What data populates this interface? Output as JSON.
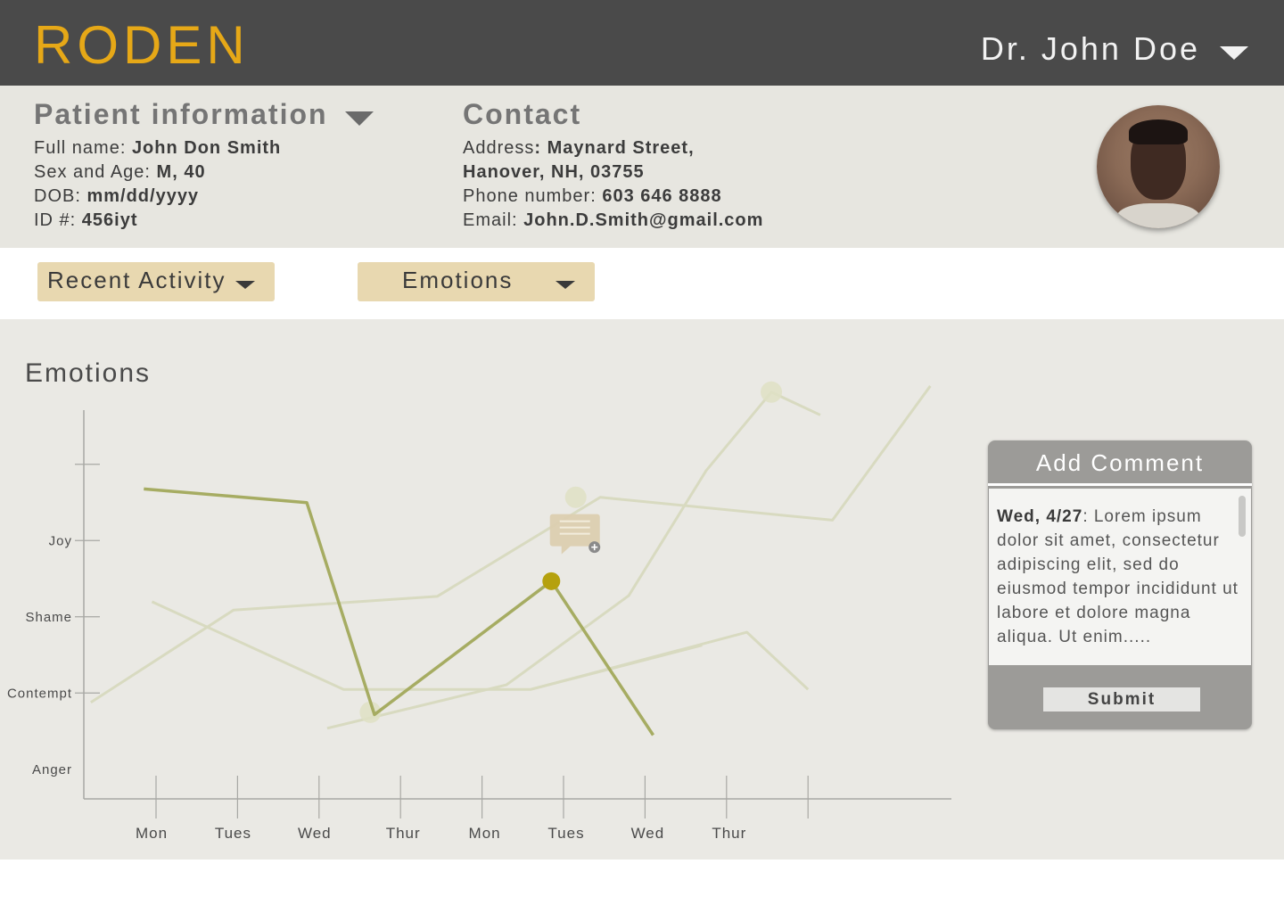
{
  "app": {
    "brand": "RODEN",
    "user": "Dr. John Doe"
  },
  "patient": {
    "title": "Patient information",
    "full_name_label": "Full name: ",
    "full_name": "John Don Smith",
    "sex_age_label": "Sex and Age: ",
    "sex_age": "M, 40",
    "dob_label": "DOB: ",
    "dob": "mm/dd/yyyy",
    "id_label": "ID #: ",
    "id": "456iyt"
  },
  "contact": {
    "title": "Contact",
    "address_label": "Address",
    "address_line1": ": Maynard Street,",
    "address_line2": "Hanover, NH, 03755",
    "phone_label": "Phone number: ",
    "phone": "603 646 8888",
    "email_label": "Email: ",
    "email": "John.D.Smith@gmail.com"
  },
  "filters": {
    "activity": "Recent Activity",
    "metric": "Emotions"
  },
  "comment": {
    "title": "Add Comment",
    "date": "Wed, 4/27",
    "text": ": Lorem ipsum dolor sit amet, consectetur adipiscing elit, sed do eiusmod tempor incididunt ut labore et dolore magna aliqua. Ut enim.....",
    "submit": "Submit"
  },
  "icons": {
    "comment_marker": "chat-bubble-plus-icon",
    "caret": "caret-down-icon"
  },
  "colors": {
    "brand": "#e6a817",
    "topbar": "#4a4a4a",
    "highlight_series": "#a6ac62",
    "faded_series": "#d8dac0",
    "selected_point": "#b5a10e"
  },
  "chart_data": {
    "type": "line",
    "title": "Emotions",
    "categories": [
      "Mon",
      "Tues",
      "Wed",
      "Thur",
      "Mon",
      "Tues",
      "Wed",
      "Thur"
    ],
    "y_levels": [
      "Anger",
      "Contempt",
      "Shame",
      "Joy"
    ],
    "grid": false,
    "series": [
      {
        "highlight": true,
        "points": [
          [
            -0.15,
            3.68
          ],
          [
            1.85,
            3.5
          ],
          [
            2.68,
            0.72
          ],
          [
            4.85,
            2.47
          ],
          [
            6.1,
            0.45
          ]
        ]
      },
      {
        "highlight": false,
        "points": [
          [
            -0.8,
            0.88
          ],
          [
            0.95,
            2.09
          ],
          [
            3.45,
            2.27
          ],
          [
            5.45,
            3.57
          ],
          [
            8.3,
            3.27
          ],
          [
            9.5,
            5.03
          ]
        ]
      },
      {
        "highlight": false,
        "points": [
          [
            -0.05,
            2.2
          ],
          [
            2.3,
            1.05
          ],
          [
            4.6,
            1.05
          ],
          [
            6.7,
            1.63
          ]
        ]
      },
      {
        "highlight": false,
        "points": [
          [
            2.1,
            0.54
          ],
          [
            4.3,
            1.11
          ],
          [
            5.8,
            2.28
          ],
          [
            6.75,
            3.92
          ],
          [
            7.55,
            4.95
          ],
          [
            8.15,
            4.65
          ]
        ]
      },
      {
        "highlight": false,
        "points": [
          [
            4.6,
            1.05
          ],
          [
            7.25,
            1.8
          ],
          [
            8.0,
            1.05
          ]
        ]
      }
    ],
    "selected_point": [
      4.85,
      2.47
    ],
    "faded_markers": [
      [
        2.63,
        0.75
      ],
      [
        5.15,
        3.57
      ],
      [
        7.55,
        4.95
      ]
    ],
    "comment_marker": [
      5.15,
      3.15
    ]
  }
}
